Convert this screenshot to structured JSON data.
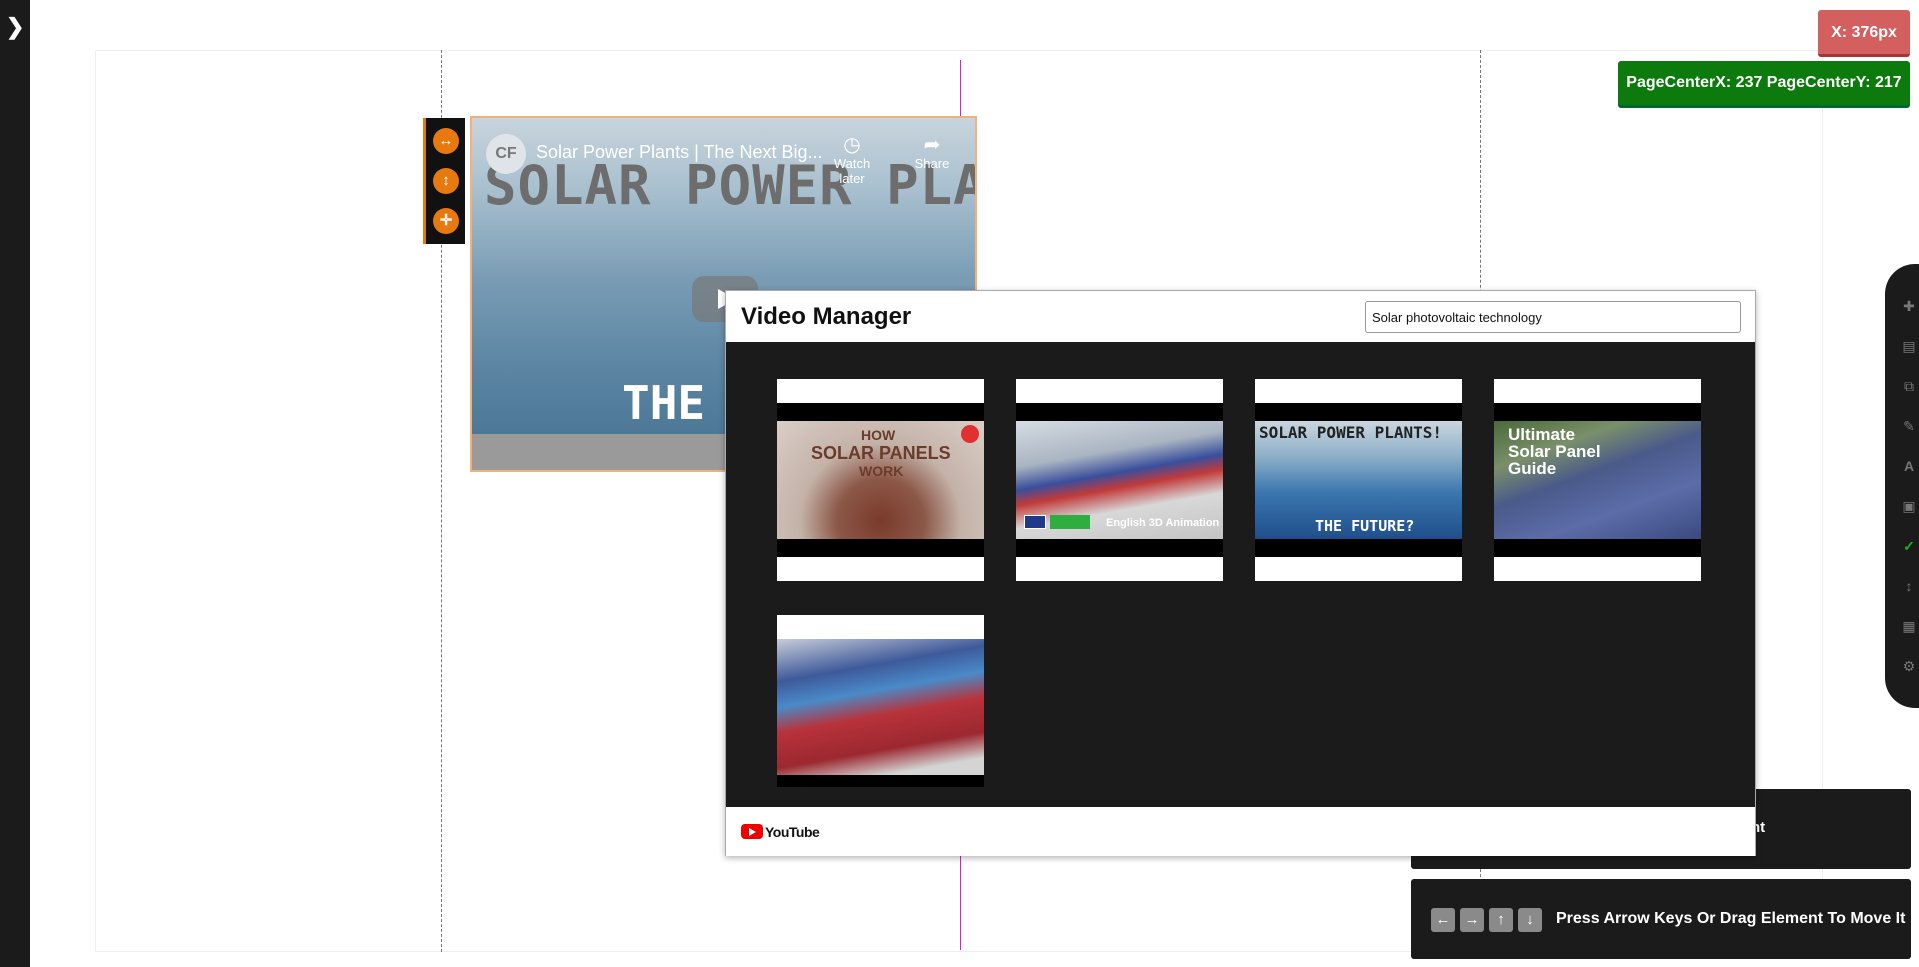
{
  "badges": {
    "x_readout": "X: 376px",
    "page_center": "PageCenterX: 237 PageCenterY: 217"
  },
  "video_element": {
    "channel_initials": "CF",
    "title": "Solar Power Plants | The Next Big...",
    "big_title": "SOLAR POWER PLANTS!",
    "sub_title": "THE FUTURE?",
    "watch_later": "Watch later",
    "share": "Share"
  },
  "video_manager": {
    "title": "Video Manager",
    "search_value": "Solar photovoltaic technology",
    "thumbnails": [
      {
        "caption_line1": "HOW",
        "caption_line2": "SOLAR PANELS",
        "caption_line3": "WORK"
      },
      {
        "caption": "English 3D Animation"
      },
      {
        "caption_line1": "SOLAR POWER PLANTS!",
        "caption_line2": "THE FUTURE?"
      },
      {
        "caption_line1": "Ultimate",
        "caption_line2": "Solar Panel",
        "caption_line3": "Guide"
      },
      {
        "caption": ""
      }
    ],
    "footer_brand": "YouTube"
  },
  "hints": {
    "hint1_partial": "nt",
    "arrow_hint": "Press Arrow Keys Or Drag Element To Move It"
  },
  "icons": {
    "left_rail": "chevron-right-icon",
    "resize": [
      "horizontal-resize-icon",
      "vertical-resize-icon",
      "move-icon"
    ],
    "right_rail": [
      "add-icon",
      "trash-icon",
      "copy-icon",
      "brush-icon",
      "text-icon",
      "image-icon",
      "check-icon",
      "height-icon",
      "grid-icon",
      "settings-icon"
    ],
    "keys": [
      "arrow-left-icon",
      "arrow-right-icon",
      "arrow-up-icon",
      "arrow-down-icon"
    ]
  },
  "colors": {
    "accent_orange": "#e8790f",
    "x_badge": "#d35f5f",
    "center_badge": "#0d7a0d",
    "guide_magenta": "#d81bd8",
    "youtube_red": "#ee0000"
  }
}
